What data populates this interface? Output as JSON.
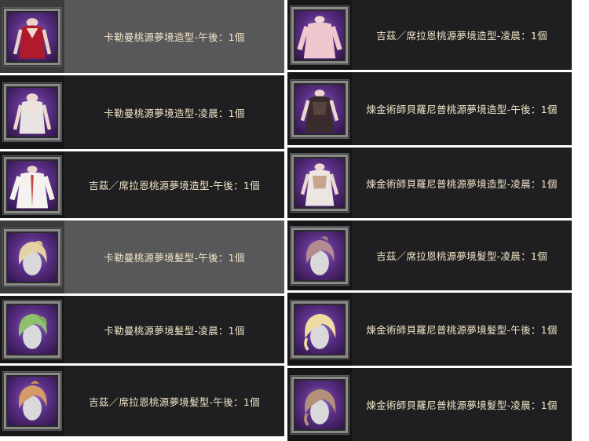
{
  "left_items": [
    {
      "label": "卡勒曼桃源夢境造型-午後：1個",
      "icon": "red-dress-outfit-icon",
      "highlight": true
    },
    {
      "label": "卡勒曼桃源夢境造型-凌晨：1個",
      "icon": "white-dress-outfit-icon",
      "highlight": false
    },
    {
      "label": "吉茲／席拉恩桃源夢境造型-午後：1個",
      "icon": "white-robe-outfit-icon",
      "highlight": false
    },
    {
      "label": "卡勒曼桃源夢境髮型-午後：1個",
      "icon": "blonde-hairstyle-icon",
      "highlight": true
    },
    {
      "label": "卡勒曼桃源夢境髮型-凌晨：1個",
      "icon": "green-hairstyle-icon",
      "highlight": false
    },
    {
      "label": "吉茲／席拉恩桃源夢境髮型-午後：1個",
      "icon": "orange-hairstyle-icon",
      "highlight": false
    }
  ],
  "right_items": [
    {
      "label": "吉茲／席拉恩桃源夢境造型-凌晨：1個",
      "icon": "pink-robe-outfit-icon",
      "highlight": false
    },
    {
      "label": "煉金術師貝羅尼普桃源夢境造型-午後：1個",
      "icon": "dark-corset-outfit-icon",
      "highlight": false
    },
    {
      "label": "煉金術師貝羅尼普桃源夢境造型-凌晨：1個",
      "icon": "white-corset-outfit-icon",
      "highlight": false
    },
    {
      "label": "吉茲／席拉恩桃源夢境髮型-凌晨：1個",
      "icon": "mauve-hairstyle-icon",
      "highlight": false
    },
    {
      "label": "煉金術師貝羅尼普桃源夢境髮型-午後：1個",
      "icon": "pale-blonde-hairstyle-icon",
      "highlight": false
    },
    {
      "label": "煉金術師貝羅尼普桃源夢境髮型-凌晨：1個",
      "icon": "brown-hairstyle-icon",
      "highlight": false
    }
  ],
  "colors": {
    "row_bg": "#1f1f21",
    "row_highlight": "#58585a",
    "label_text": "#f3e6c8",
    "thumb_bg": "#5a2f85"
  }
}
